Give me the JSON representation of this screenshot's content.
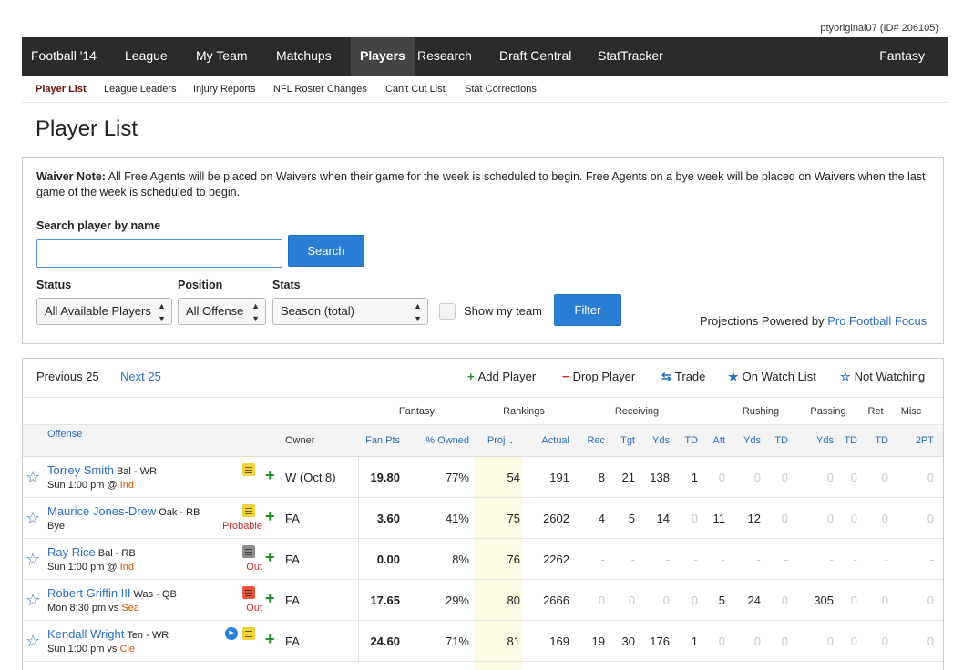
{
  "user": "ptyoriginal07 (ID# 206105)",
  "topnav": [
    "Football '14",
    "League",
    "My Team",
    "Matchups",
    "Players",
    "Research",
    "Draft Central",
    "StatTracker",
    "Fantasy"
  ],
  "subnav": [
    "Player List",
    "League Leaders",
    "Injury Reports",
    "NFL Roster Changes",
    "Can't Cut List",
    "Stat Corrections"
  ],
  "page_title": "Player List",
  "waiver": {
    "label": "Waiver Note:",
    "text": " All Free Agents will be placed on Waivers when their game for the week is scheduled to begin. Free Agents on a bye week will be placed on Waivers when the last game of the week is scheduled to begin."
  },
  "search": {
    "label": "Search player by name",
    "value": "",
    "button": "Search"
  },
  "filters": {
    "status_label": "Status",
    "status_value": "All Available Players",
    "position_label": "Position",
    "position_value": "All Offense",
    "stats_label": "Stats",
    "stats_value": "Season (total)",
    "show_my_team": "Show my team",
    "filter_button": "Filter"
  },
  "powered": {
    "prefix": "Projections Powered by ",
    "link": "Pro Football Focus"
  },
  "pager": {
    "prev": "Previous 25",
    "next": "Next 25"
  },
  "legend": {
    "add": "Add Player",
    "drop": "Drop Player",
    "trade": "Trade",
    "watch": "On Watch List",
    "not_watching": "Not Watching"
  },
  "groups": [
    "Fantasy",
    "Rankings",
    "Receiving",
    "Rushing",
    "Passing",
    "Ret",
    "Misc"
  ],
  "headers": [
    "Offense",
    "Owner",
    "Fan Pts",
    "% Owned",
    "Proj",
    "Actual",
    "Rec",
    "Tgt",
    "Yds",
    "TD",
    "Att",
    "Yds",
    "TD",
    "Yds",
    "TD",
    "TD",
    "2PT"
  ],
  "players": [
    {
      "name": "Torrey Smith",
      "team": "Bal - WR",
      "game_prefix": "Sun 1:00 pm @ ",
      "opp": "Ind",
      "status": "",
      "note_color": "#f2d23a",
      "video": false,
      "owner": "W (Oct 8)",
      "stats": [
        "19.80",
        "77%",
        "54",
        "191",
        "8",
        "21",
        "138",
        "1",
        "0",
        "0",
        "0",
        "0",
        "0",
        "0",
        "0"
      ]
    },
    {
      "name": "Maurice Jones-Drew",
      "team": "Oak - RB",
      "game_prefix": "Bye",
      "opp": "",
      "status": "Probable",
      "note_color": "#f2d23a",
      "video": false,
      "owner": "FA",
      "stats": [
        "3.60",
        "41%",
        "75",
        "2602",
        "4",
        "5",
        "14",
        "0",
        "11",
        "12",
        "0",
        "0",
        "0",
        "0",
        "0"
      ]
    },
    {
      "name": "Ray Rice",
      "team": "Bal - RB",
      "game_prefix": "Sun 1:00 pm @ ",
      "opp": "Ind",
      "status": "Out",
      "note_color": "#8c8c8c",
      "video": false,
      "owner": "FA",
      "stats": [
        "0.00",
        "8%",
        "76",
        "2262",
        "-",
        "-",
        "-",
        "-",
        "-",
        "-",
        "-",
        "-",
        "-",
        "-",
        "-"
      ]
    },
    {
      "name": "Robert Griffin III",
      "team": "Was - QB",
      "game_prefix": "Mon 8:30 pm vs ",
      "opp": "Sea",
      "status": "Out",
      "note_color": "#e8573a",
      "video": false,
      "owner": "FA",
      "stats": [
        "17.65",
        "29%",
        "80",
        "2666",
        "0",
        "0",
        "0",
        "0",
        "5",
        "24",
        "0",
        "305",
        "0",
        "0",
        "0"
      ]
    },
    {
      "name": "Kendall Wright",
      "team": "Ten - WR",
      "game_prefix": "Sun 1:00 pm vs ",
      "opp": "Cle",
      "status": "",
      "note_color": "#f2d23a",
      "video": true,
      "owner": "FA",
      "stats": [
        "24.60",
        "71%",
        "81",
        "169",
        "19",
        "30",
        "176",
        "1",
        "0",
        "0",
        "0",
        "0",
        "0",
        "0",
        "0"
      ]
    }
  ]
}
